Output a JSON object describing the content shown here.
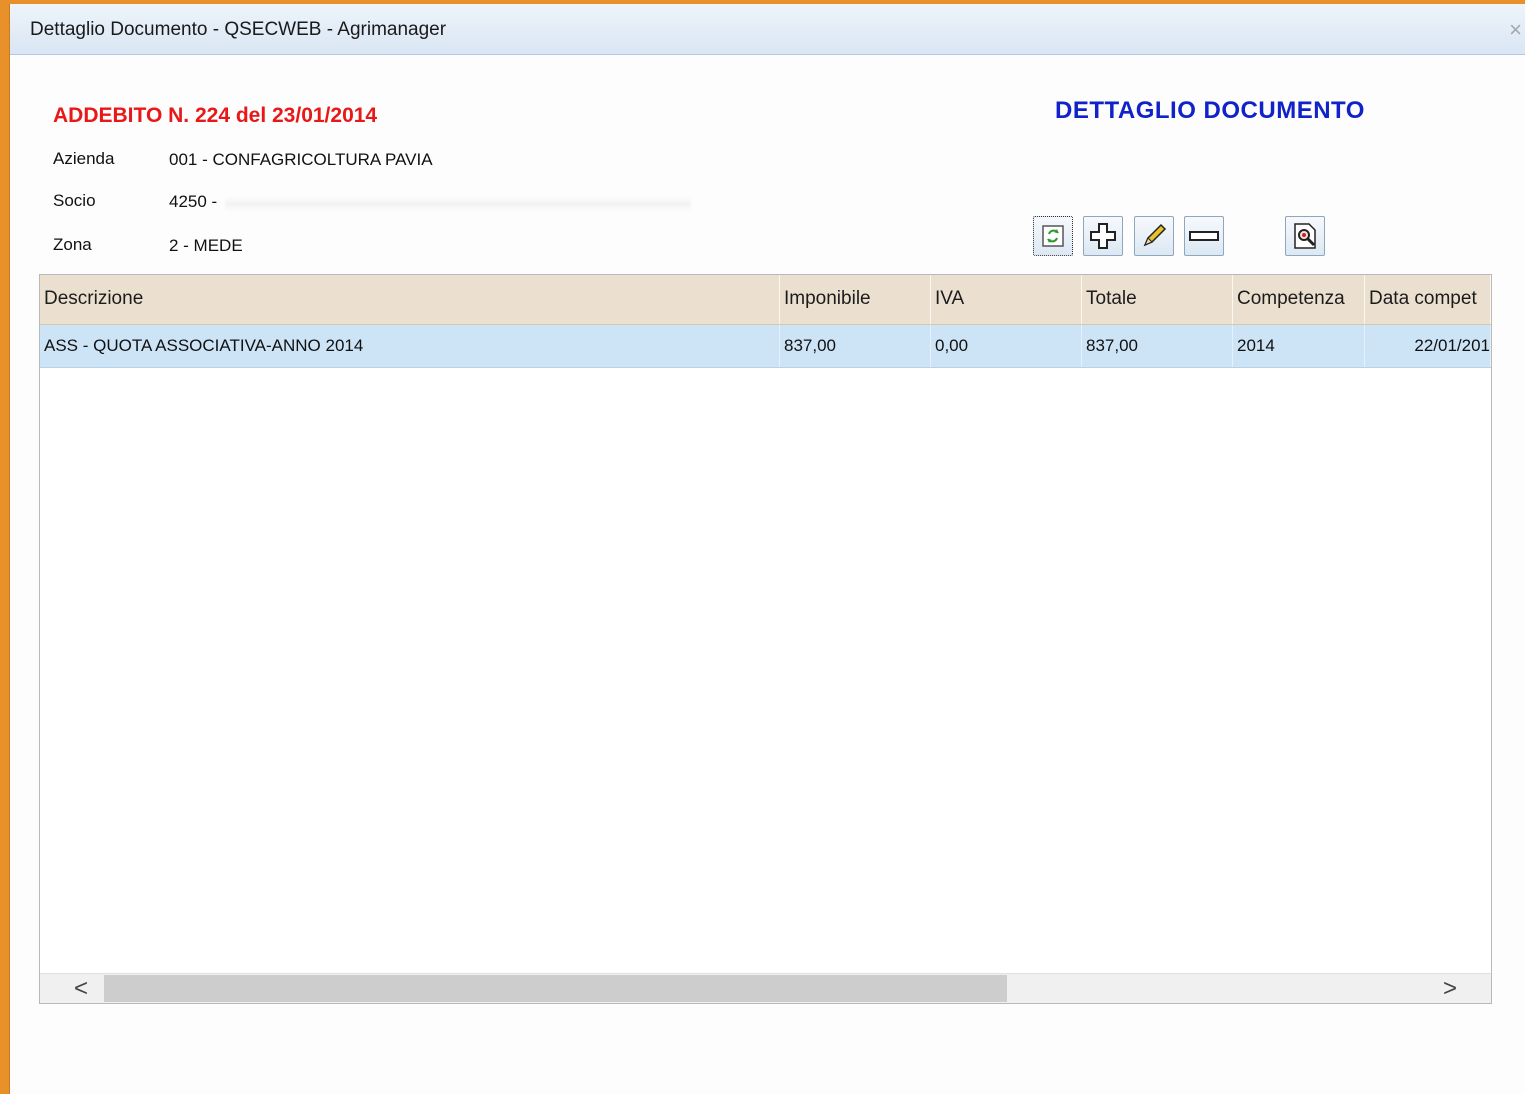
{
  "window": {
    "title": "Dettaglio Documento - QSECWEB - Agrimanager",
    "close_label": "×"
  },
  "document": {
    "title": "ADDEBITO N. 224 del 23/01/2014",
    "panel_title": "DETTAGLIO DOCUMENTO",
    "fields": {
      "azienda_label": "Azienda",
      "azienda_value": "001 - CONFAGRICOLTURA PAVIA",
      "socio_label": "Socio",
      "socio_value": "4250 -",
      "zona_label": "Zona",
      "zona_value": "2 - MEDE"
    }
  },
  "toolbar": {
    "buttons": [
      {
        "icon": "refresh-icon"
      },
      {
        "icon": "plus-icon"
      },
      {
        "icon": "pencil-icon"
      },
      {
        "icon": "minus-icon"
      },
      {
        "icon": "search-document-icon"
      }
    ]
  },
  "grid": {
    "columns": [
      "Descrizione",
      "Imponibile",
      "IVA",
      "Totale",
      "Competenza",
      "Data compet"
    ],
    "rows": [
      {
        "descrizione": "ASS - QUOTA ASSOCIATIVA-ANNO 2014",
        "imponibile": "837,00",
        "iva": "0,00",
        "totale": "837,00",
        "competenza": "2014",
        "data_competenza": "22/01/201"
      }
    ],
    "scroll_left": "<",
    "scroll_right": ">"
  },
  "colors": {
    "accent_red": "#e81818",
    "accent_blue": "#1022c8",
    "selected_row": "#cde4f7",
    "header_bg": "#ebe0d0"
  }
}
